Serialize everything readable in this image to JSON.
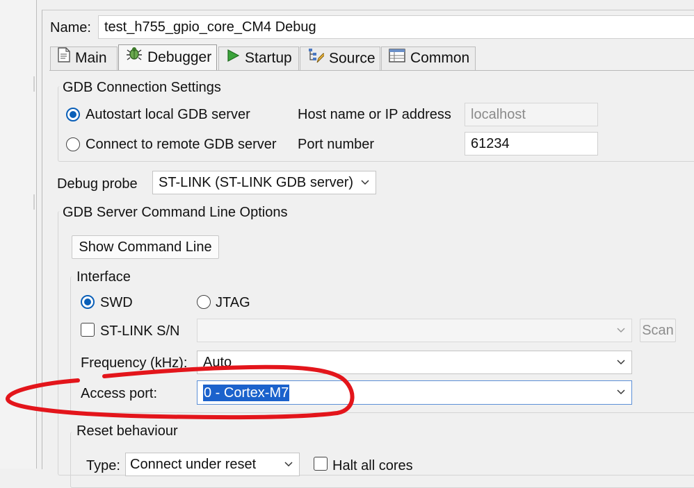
{
  "name_field": {
    "label": "Name:",
    "value": "test_h755_gpio_core_CM4 Debug"
  },
  "tabs": [
    {
      "label": "Main",
      "icon": "document-icon"
    },
    {
      "label": "Debugger",
      "icon": "bug-icon"
    },
    {
      "label": "Startup",
      "icon": "play-icon"
    },
    {
      "label": "Source",
      "icon": "source-lookup-icon"
    },
    {
      "label": "Common",
      "icon": "table-icon"
    }
  ],
  "gdb_connection": {
    "title": "GDB Connection Settings",
    "autostart_label": "Autostart local GDB server",
    "remote_label": "Connect to remote GDB server",
    "host_label": "Host name or IP address",
    "host_value": "localhost",
    "port_label": "Port number",
    "port_value": "61234"
  },
  "debug_probe": {
    "label": "Debug probe",
    "value": "ST-LINK (ST-LINK GDB server)"
  },
  "gdb_server_options": {
    "title": "GDB Server Command Line Options",
    "show_cmd_button": "Show Command Line"
  },
  "interface": {
    "title": "Interface",
    "swd_label": "SWD",
    "jtag_label": "JTAG",
    "stlink_sn_label": "ST-LINK S/N",
    "scan_button": "Scan",
    "frequency_label": "Frequency (kHz):",
    "frequency_value": "Auto",
    "access_port_label": "Access port:",
    "access_port_value": "0 - Cortex-M7"
  },
  "reset": {
    "title": "Reset behaviour",
    "type_label": "Type:",
    "type_value": "Connect under reset",
    "halt_all_label": "Halt all cores"
  },
  "colors": {
    "accent": "#0a5fb8",
    "selection": "#1b62cc",
    "annotation": "#e3151b"
  }
}
